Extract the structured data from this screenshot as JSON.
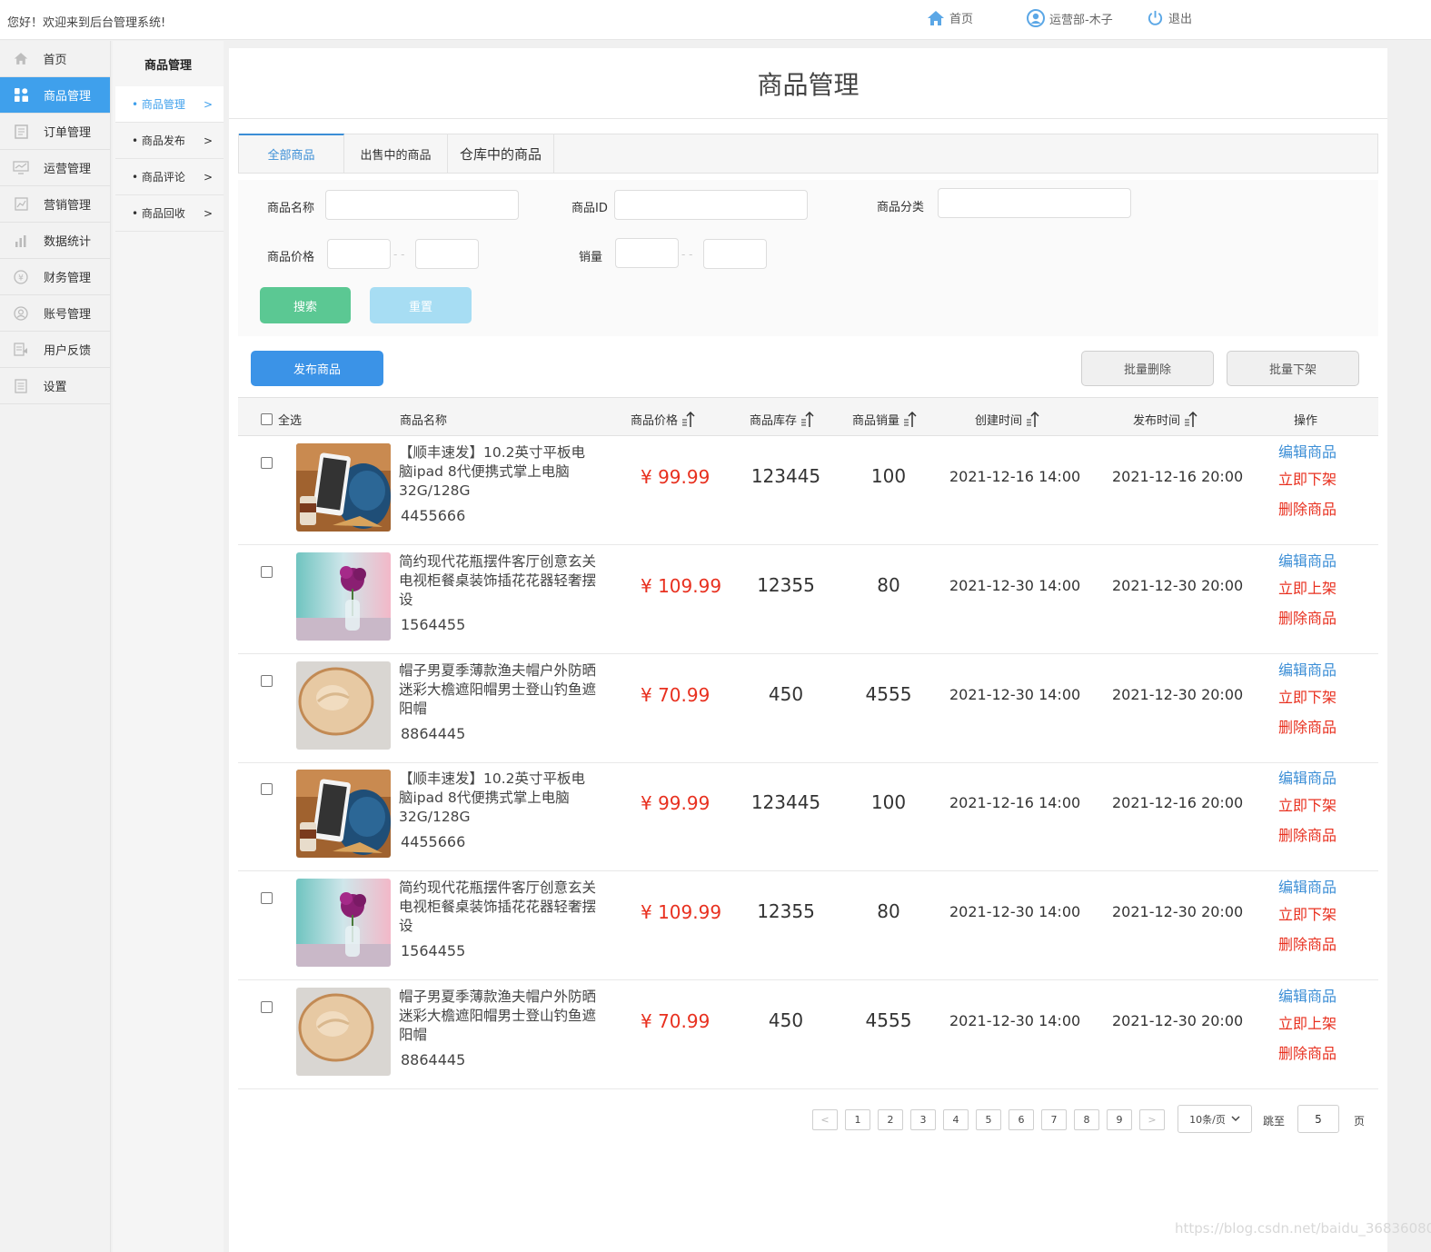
{
  "topbar": {
    "welcome": "您好！欢迎来到后台管理系统!",
    "home": "首页",
    "user": "运营部-木子",
    "logout": "退出"
  },
  "sidebar": {
    "items": [
      {
        "label": "首页",
        "icon": "home-icon"
      },
      {
        "label": "商品管理",
        "icon": "grid-icon",
        "active": true
      },
      {
        "label": "订单管理",
        "icon": "order-icon"
      },
      {
        "label": "运营管理",
        "icon": "monitor-chart-icon"
      },
      {
        "label": "营销管理",
        "icon": "marketing-chart-icon"
      },
      {
        "label": "数据统计",
        "icon": "bar-chart-icon"
      },
      {
        "label": "财务管理",
        "icon": "currency-icon"
      },
      {
        "label": "账号管理",
        "icon": "user-icon"
      },
      {
        "label": "用户反馈",
        "icon": "feedback-icon"
      },
      {
        "label": "设置",
        "icon": "settings-doc-icon"
      }
    ]
  },
  "subbar": {
    "title": "商品管理",
    "items": [
      {
        "label": "• 商品管理",
        "arrow": ">",
        "active": true
      },
      {
        "label": "• 商品发布",
        "arrow": ">"
      },
      {
        "label": "• 商品评论",
        "arrow": ">"
      },
      {
        "label": "• 商品回收",
        "arrow": ">"
      }
    ]
  },
  "main": {
    "title": "商品管理",
    "tabs": [
      "全部商品",
      "出售中的商品",
      "仓库中的商品"
    ],
    "filter": {
      "name_label": "商品名称",
      "id_label": "商品ID",
      "category_label": "商品分类",
      "price_label": "商品价格",
      "sales_label": "销量",
      "range_sep": "- -",
      "search": "搜索",
      "reset": "重置"
    },
    "actions": {
      "publish": "发布商品",
      "batch_delete": "批量删除",
      "batch_off": "批量下架"
    },
    "table": {
      "headers": {
        "select_all": "全选",
        "name": "商品名称",
        "price": "商品价格",
        "stock": "商品库存",
        "sales": "商品销量",
        "created": "创建时间",
        "published": "发布时间",
        "ops": "操作"
      },
      "rows": [
        {
          "image": "tablet",
          "name": "【顺丰速发】10.2英寸平板电脑ipad 8代便携式掌上电脑32G/128G",
          "id": "4455666",
          "price": "¥  99.99",
          "stock": "123445",
          "sales": "100",
          "created": "2021-12-16 14:00",
          "published": "2021-12-16 20:00",
          "edit": "编辑商品",
          "shelf": "立即下架",
          "delete": "删除商品"
        },
        {
          "image": "vase",
          "name": "简约现代花瓶摆件客厅创意玄关电视柜餐桌装饰插花花器轻奢摆设",
          "id": "1564455",
          "price": "¥ 109.99",
          "stock": "12355",
          "sales": "80",
          "created": "2021-12-30 14:00",
          "published": "2021-12-30  20:00",
          "edit": "编辑商品",
          "shelf": "立即上架",
          "delete": "删除商品"
        },
        {
          "image": "hat",
          "name": "帽子男夏季薄款渔夫帽户外防晒迷彩大檐遮阳帽男士登山钓鱼遮阳帽",
          "id": "8864445",
          "price": "¥  70.99",
          "stock": "450",
          "sales": "4555",
          "created": "2021-12-30 14:00",
          "published": "2021-12-30  20:00",
          "edit": "编辑商品",
          "shelf": "立即下架",
          "delete": "删除商品"
        },
        {
          "image": "tablet",
          "name": "【顺丰速发】10.2英寸平板电脑ipad 8代便携式掌上电脑32G/128G",
          "id": "4455666",
          "price": "¥  99.99",
          "stock": "123445",
          "sales": "100",
          "created": "2021-12-16 14:00",
          "published": "2021-12-16 20:00",
          "edit": "编辑商品",
          "shelf": "立即下架",
          "delete": "删除商品"
        },
        {
          "image": "vase",
          "name": "简约现代花瓶摆件客厅创意玄关电视柜餐桌装饰插花花器轻奢摆设",
          "id": "1564455",
          "price": "¥ 109.99",
          "stock": "12355",
          "sales": "80",
          "created": "2021-12-30 14:00",
          "published": "2021-12-30  20:00",
          "edit": "编辑商品",
          "shelf": "立即下架",
          "delete": "删除商品"
        },
        {
          "image": "hat",
          "name": "帽子男夏季薄款渔夫帽户外防晒迷彩大檐遮阳帽男士登山钓鱼遮阳帽",
          "id": "8864445",
          "price": "¥  70.99",
          "stock": "450",
          "sales": "4555",
          "created": "2021-12-30 14:00",
          "published": "2021-12-30  20:00",
          "edit": "编辑商品",
          "shelf": "立即上架",
          "delete": "删除商品"
        }
      ]
    },
    "pagination": {
      "prev": "<",
      "next": ">",
      "pages": [
        "1",
        "2",
        "3",
        "4",
        "5",
        "6",
        "7",
        "8",
        "9"
      ],
      "page_size": "10条/页",
      "jump_label": "跳至",
      "jump_value": "5",
      "page_suffix": "页"
    }
  },
  "watermark": "https://blog.csdn.net/baidu_36836080",
  "colors": {
    "accent": "#3fa0ec",
    "price_red": "#e8301f",
    "link_blue": "#3b8ed6",
    "search_green": "#5bc893",
    "reset_blue": "#a7ddf3"
  }
}
